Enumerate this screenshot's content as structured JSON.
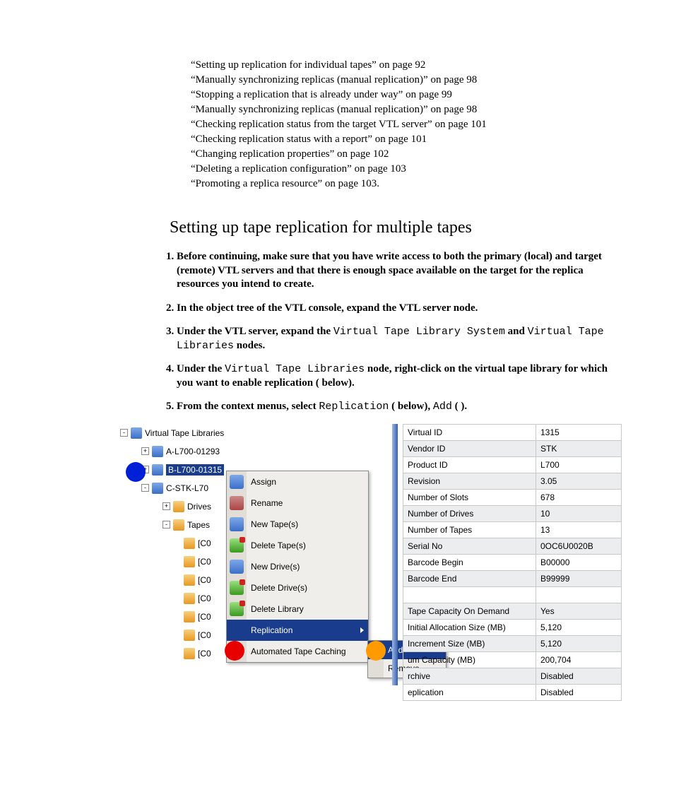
{
  "crossrefs": [
    "“Setting up replication for individual tapes” on page 92",
    "“Manually synchronizing replicas (manual replication)” on page 98",
    "“Stopping a replication that is already under way” on page 99",
    "“Manually synchronizing replicas (manual replication)” on page 98",
    "“Checking replication status from the target VTL server” on page 101",
    "“Checking replication status with a report” on page 101",
    "“Changing replication properties” on page 102",
    "“Deleting a replication configuration” on page 103",
    "“Promoting a replica resource” on page 103."
  ],
  "section_title": "Setting up tape replication for multiple tapes",
  "steps": {
    "s1": "Before continuing, make sure that you have write access to both the primary (local) and target (remote) VTL servers and that there is enough space available on the target for the replica resources you intend to create.",
    "s2": "In the object tree of the VTL console, expand the VTL server node.",
    "s3_a": "Under the VTL server, expand the ",
    "s3_b": "Virtual Tape Library System",
    "s3_c": " and ",
    "s3_d": "Virtual Tape Libraries",
    "s3_e": " nodes.",
    "s4_a": "Under the ",
    "s4_b": "Virtual Tape Libraries",
    "s4_c": " node, right-click on the virtual tape library for which you want to enable replication (   below).",
    "s5_a": "From the context menus, select ",
    "s5_b": "Replication",
    "s5_c": " (   below), ",
    "s5_d": "Add",
    "s5_e": " (  )."
  },
  "tree": {
    "root": "Virtual Tape Libraries",
    "a": "A-L700-01293",
    "b": "B-L700-01315",
    "c": "C-STK-L70",
    "drives": "Drives",
    "tapes": "Tapes",
    "rows": [
      "[C0",
      "[C0",
      "[C0",
      "[C0",
      "[C0",
      "[C0",
      "[C0"
    ]
  },
  "ctx": {
    "assign": "Assign",
    "rename": "Rename",
    "newtape": "New Tape(s)",
    "deltape": "Delete Tape(s)",
    "newdrive": "New Drive(s)",
    "deldrive": "Delete Drive(s)",
    "dellib": "Delete Library",
    "replication": "Replication",
    "atc": "Automated Tape Caching"
  },
  "sub": {
    "add": "Add",
    "remove": "Remove"
  },
  "props": [
    [
      "Virtual ID",
      "1315"
    ],
    [
      "Vendor ID",
      "STK"
    ],
    [
      "Product ID",
      "L700"
    ],
    [
      "Revision",
      "3.05"
    ],
    [
      "Number of Slots",
      "678"
    ],
    [
      "Number of Drives",
      "10"
    ],
    [
      "Number of Tapes",
      "13"
    ],
    [
      "Serial No",
      "0OC6U0020B"
    ],
    [
      "Barcode Begin",
      "B00000"
    ],
    [
      "Barcode End",
      "B99999"
    ],
    [
      "",
      ""
    ],
    [
      "Tape Capacity On Demand",
      "Yes"
    ],
    [
      "Initial Allocation Size (MB)",
      "5,120"
    ],
    [
      "Increment Size (MB)",
      "5,120"
    ],
    [
      "um Capacity (MB)",
      "200,704"
    ],
    [
      "rchive",
      "Disabled"
    ],
    [
      "eplication",
      "Disabled"
    ]
  ]
}
